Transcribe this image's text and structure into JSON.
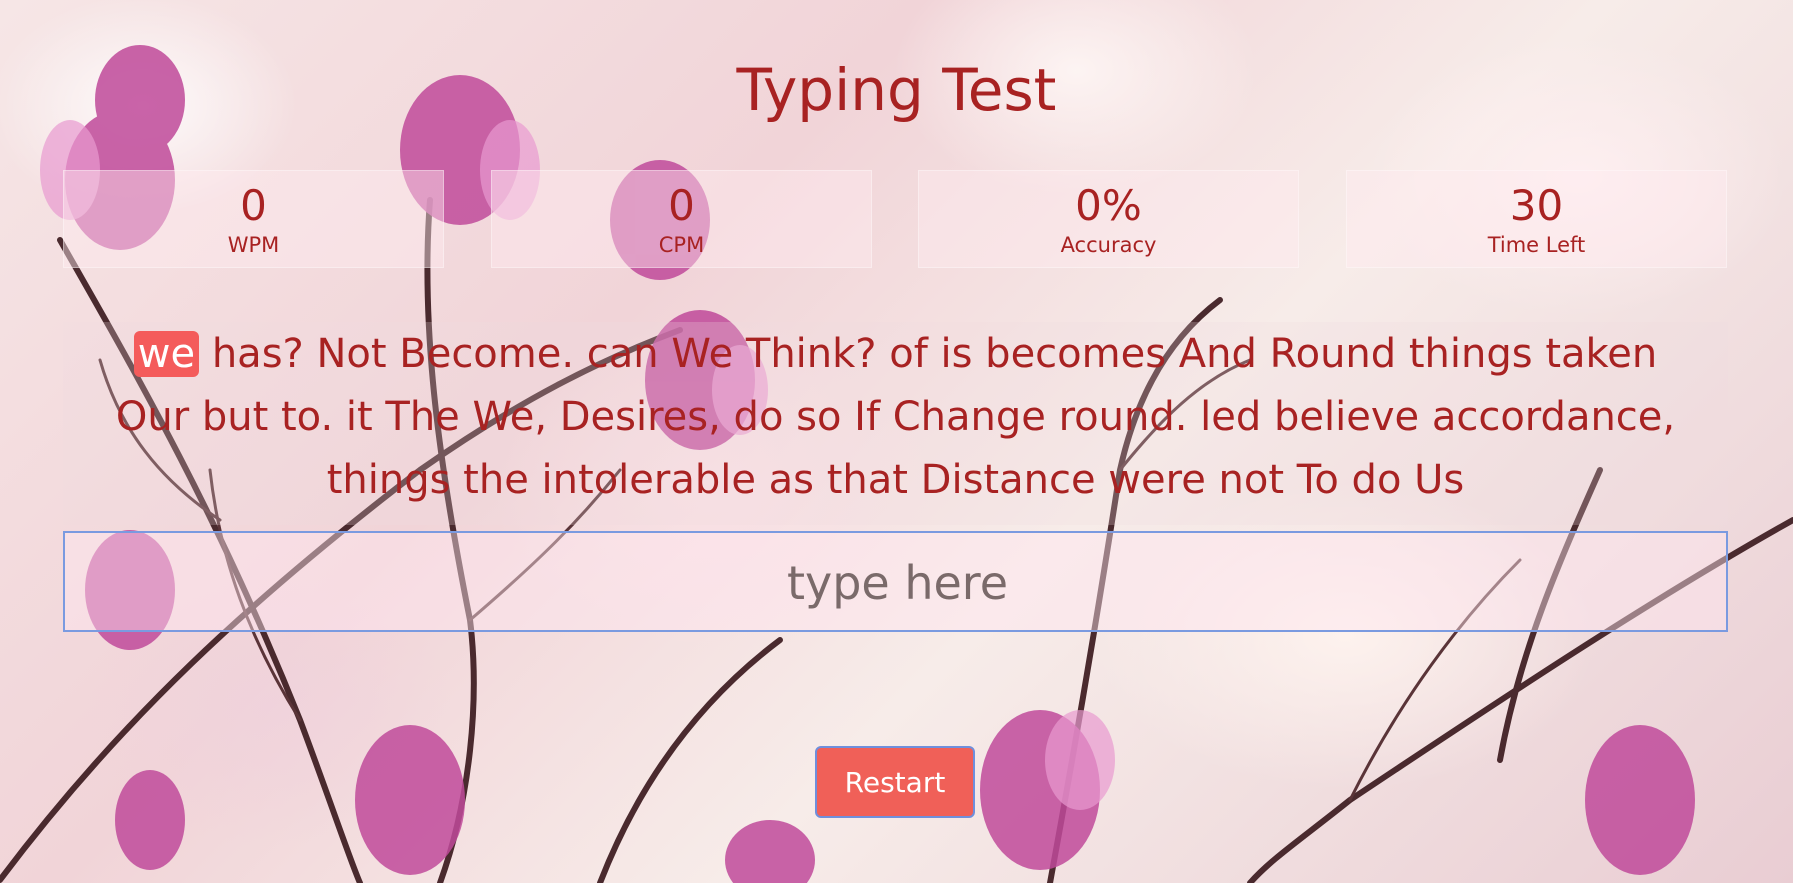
{
  "app": {
    "title": "Typing Test"
  },
  "stats": [
    {
      "value": "0",
      "label": "WPM"
    },
    {
      "value": "0",
      "label": "CPM"
    },
    {
      "value": "0%",
      "label": "Accuracy"
    },
    {
      "value": "30",
      "label": "Time Left"
    }
  ],
  "quote": {
    "current_word": "we",
    "rest": " has? Not Become. can We Think? of is becomes And Round things taken Our but to. it The We, Desires, do so If Change round. led believe accordance, things the intolerable as that Distance were not To do Us"
  },
  "input": {
    "placeholder": "type here",
    "value": ""
  },
  "restart": {
    "label": "Restart"
  },
  "colors": {
    "text": "#a82222",
    "highlight": "#f45b5b",
    "button": "#f06058",
    "focus_border": "#7a9ae0"
  }
}
